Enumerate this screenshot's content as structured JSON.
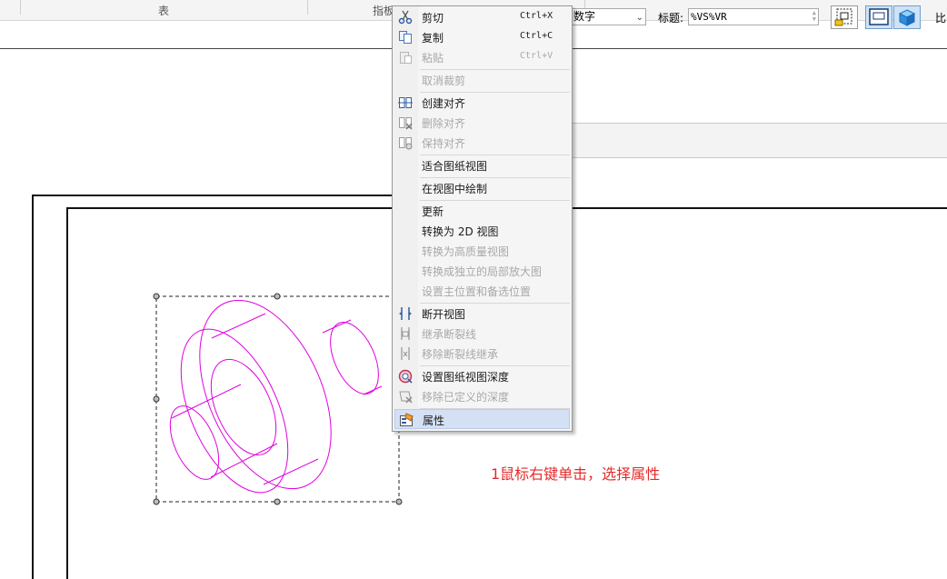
{
  "ribbon": {
    "col_1_label": "表",
    "col_2_label": "指板"
  },
  "toolbar": {
    "label_select_value": "数字",
    "title_label": "标题:",
    "title_value": "%VS%VR",
    "scale_label_partial": "比"
  },
  "context_menu": {
    "items": [
      {
        "id": "cut",
        "label": "剪切",
        "shortcut": "Ctrl+X",
        "icon": "scissors-icon",
        "enabled": true
      },
      {
        "id": "copy",
        "label": "复制",
        "shortcut": "Ctrl+C",
        "icon": "copy-icon",
        "enabled": true
      },
      {
        "id": "paste",
        "label": "粘贴",
        "shortcut": "Ctrl+V",
        "icon": "paste-icon",
        "enabled": false
      },
      {
        "id": "cancel-crop",
        "label": "取消裁剪",
        "enabled": false
      },
      {
        "id": "create-align",
        "label": "创建对齐",
        "icon": "create-align-icon",
        "enabled": true
      },
      {
        "id": "delete-align",
        "label": "删除对齐",
        "icon": "delete-align-icon",
        "enabled": false
      },
      {
        "id": "keep-align",
        "label": "保持对齐",
        "icon": "keep-align-icon",
        "enabled": false
      },
      {
        "id": "fit-sheet",
        "label": "适合图纸视图",
        "enabled": true
      },
      {
        "id": "draw-in-view",
        "label": "在视图中绘制",
        "enabled": true
      },
      {
        "id": "update",
        "label": "更新",
        "enabled": true
      },
      {
        "id": "convert-2d",
        "label": "转换为 2D 视图",
        "enabled": true
      },
      {
        "id": "convert-hq",
        "label": "转换为高质量视图",
        "enabled": false
      },
      {
        "id": "convert-detail",
        "label": "转换成独立的局部放大图",
        "enabled": false
      },
      {
        "id": "set-position",
        "label": "设置主位置和备选位置",
        "enabled": false
      },
      {
        "id": "break-view",
        "label": "断开视图",
        "icon": "break-view-icon",
        "enabled": true
      },
      {
        "id": "inherit-break",
        "label": "继承断裂线",
        "icon": "inherit-break-icon",
        "enabled": false
      },
      {
        "id": "remove-break-inherit",
        "label": "移除断裂线继承",
        "icon": "remove-break-icon",
        "enabled": false
      },
      {
        "id": "set-depth",
        "label": "设置图纸视图深度",
        "icon": "view-depth-icon",
        "enabled": true
      },
      {
        "id": "remove-depth",
        "label": "移除已定义的深度",
        "icon": "remove-depth-icon",
        "enabled": false
      },
      {
        "id": "properties",
        "label": "属性",
        "icon": "properties-icon",
        "enabled": true,
        "highlighted": true
      }
    ]
  },
  "annotation": "1鼠标右键单击，选择属性",
  "colors": {
    "geometry": "#e000e0",
    "annotation": "#e32b2b",
    "menu_highlight": "#d4e0f3"
  }
}
